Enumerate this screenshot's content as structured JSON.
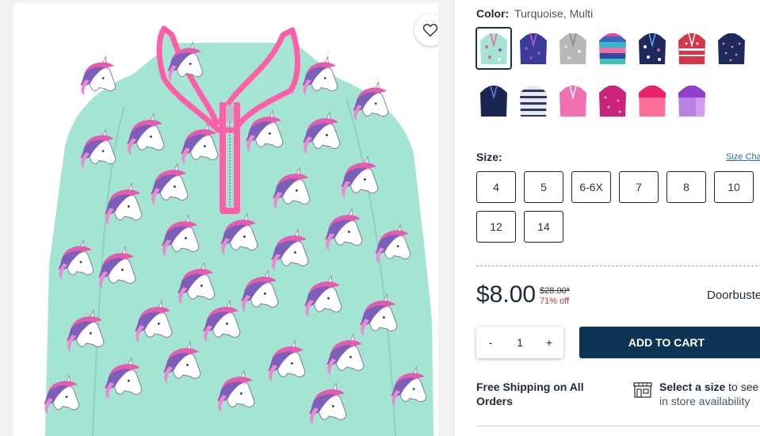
{
  "product": {
    "favorite_icon": "heart-outline-icon",
    "image_alt": "Unicode print quarter-zip fleece pullover"
  },
  "color": {
    "label": "Color:",
    "value": "Turquoise, Multi",
    "swatches": [
      {
        "name": "turquoise-unicorn",
        "selected": true
      },
      {
        "name": "navy-purple"
      },
      {
        "name": "grey-print"
      },
      {
        "name": "rainbow-stripe"
      },
      {
        "name": "navy-unicorn"
      },
      {
        "name": "red-fairisle"
      },
      {
        "name": "navy-dot"
      },
      {
        "name": "navy-solid"
      },
      {
        "name": "grey-stripe"
      },
      {
        "name": "pink-solid"
      },
      {
        "name": "magenta-print"
      },
      {
        "name": "pink-colorblock"
      },
      {
        "name": "purple-colorblock"
      }
    ]
  },
  "size": {
    "label": "Size:",
    "chart_link": "Size Chart",
    "options": [
      "4",
      "5",
      "6-6X",
      "7",
      "8",
      "10",
      "12",
      "14"
    ]
  },
  "pricing": {
    "price": "$8.00",
    "original": "$28.00*",
    "discount": "71% off",
    "badge": "Doorbuster"
  },
  "cart": {
    "minus": "-",
    "quantity": "1",
    "plus": "+",
    "add_label": "ADD TO CART"
  },
  "shipping": {
    "free_shipping": "Free Shipping on All Orders",
    "store_bold": "Select a size",
    "store_rest": " to see",
    "store_line2": "in store availability"
  }
}
